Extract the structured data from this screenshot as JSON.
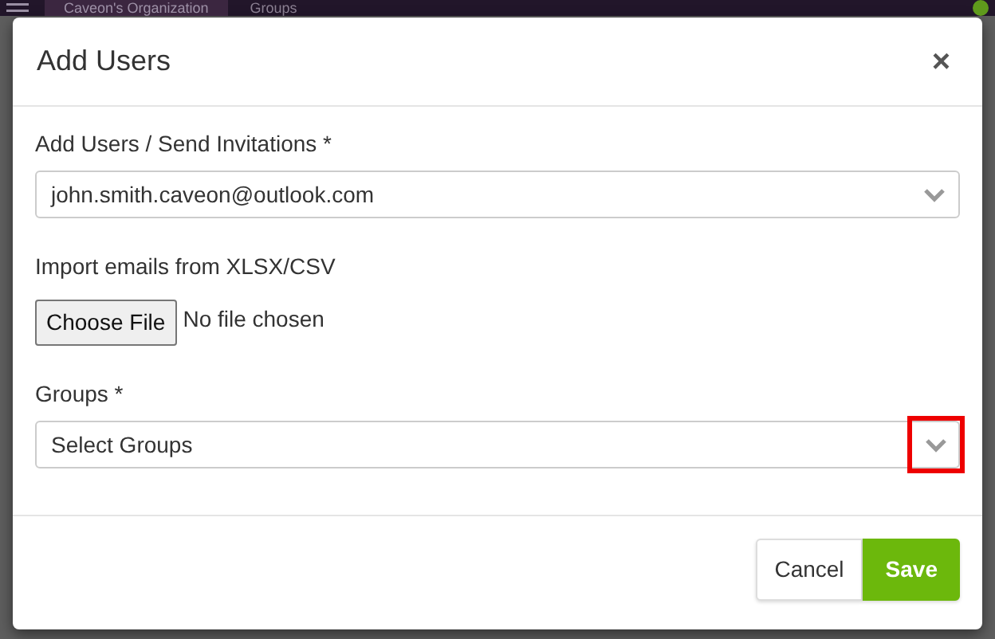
{
  "topbar": {
    "organization": "Caveon's Organization",
    "nav_item": "Groups"
  },
  "dialog": {
    "title": "Add Users",
    "close": "×",
    "fields": [
      {
        "kind": "select",
        "label": "Add Users / Send Invitations *",
        "value": "john.smith.caveon@outlook.com",
        "chevron_highlighted": false
      },
      {
        "kind": "file",
        "label": "Import emails from XLSX/CSV",
        "button": "Choose File",
        "status": "No file chosen"
      },
      {
        "kind": "select",
        "label": "Groups *",
        "placeholder": "Select Groups",
        "chevron_highlighted": true
      }
    ],
    "buttons": [
      {
        "label": "Cancel",
        "kind": "secondary"
      },
      {
        "label": "Save",
        "kind": "primary"
      }
    ]
  }
}
